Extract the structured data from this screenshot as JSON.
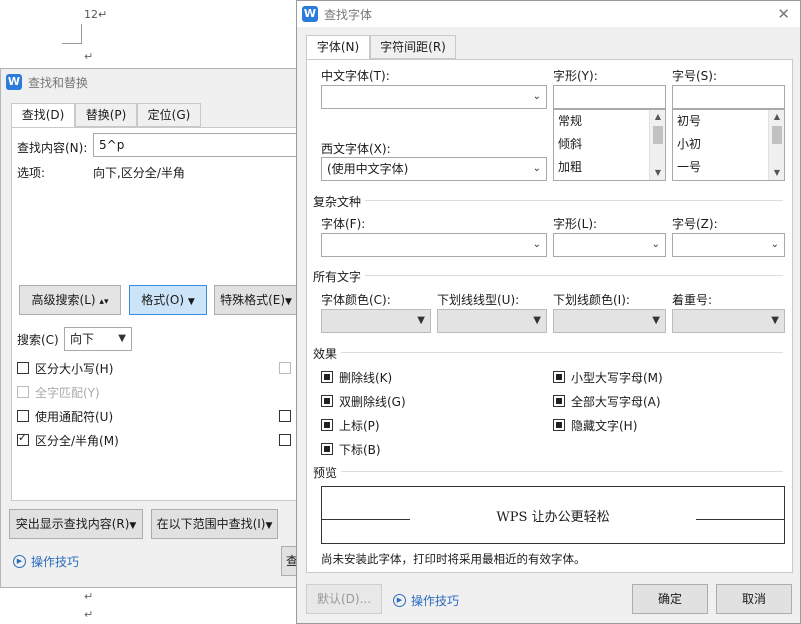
{
  "document": {
    "page_number_text": "12↵",
    "para_marks": [
      "↵",
      "↵",
      "↵"
    ]
  },
  "find_replace": {
    "title": "查找和替换",
    "tabs": [
      "查找(D)",
      "替换(P)",
      "定位(G)"
    ],
    "find_label": "查找内容(N):",
    "find_value": "5^p",
    "options_label": "选项:",
    "options_value": "向下,区分全/半角",
    "advanced_button": "高级搜索(L)",
    "format_button": "格式(O)",
    "special_button": "特殊格式(E)",
    "search_label": "搜索(C)",
    "search_value": "向下",
    "checkboxes": [
      {
        "label": "区分大小写(H)",
        "checked": false,
        "disabled": false
      },
      {
        "label": "全字匹配(Y)",
        "checked": false,
        "disabled": true
      },
      {
        "label": "使用通配符(U)",
        "checked": false,
        "disabled": false
      },
      {
        "label": "区分全/半角(M)",
        "checked": true,
        "disabled": false
      }
    ],
    "highlight_button": "突出显示查找内容(R)",
    "find_in_button": "在以下范围中查找(I)",
    "find_next_partial": "查",
    "tips_label": "操作技巧"
  },
  "find_font": {
    "title": "查找字体",
    "tabs": [
      "字体(N)",
      "字符间距(R)"
    ],
    "chinese_font_label": "中文字体(T):",
    "chinese_font_value": "",
    "style_label": "字形(Y):",
    "style_value": "",
    "style_options": [
      "常规",
      "倾斜",
      "加粗"
    ],
    "size_label": "字号(S):",
    "size_value": "",
    "size_options": [
      "初号",
      "小初",
      "一号"
    ],
    "western_font_label": "西文字体(X):",
    "western_font_value": "(使用中文字体)",
    "complex_section": "复杂文种",
    "complex_font_label": "字体(F):",
    "complex_style_label": "字形(L):",
    "complex_size_label": "字号(Z):",
    "all_text_section": "所有文字",
    "font_color_label": "字体颜色(C):",
    "underline_type_label": "下划线线型(U):",
    "underline_color_label": "下划线颜色(I):",
    "emphasis_label": "着重号:",
    "effects_section": "效果",
    "effects_left": [
      "删除线(K)",
      "双删除线(G)",
      "上标(P)",
      "下标(B)"
    ],
    "effects_right": [
      "小型大写字母(M)",
      "全部大写字母(A)",
      "隐藏文字(H)"
    ],
    "preview_section": "预览",
    "preview_text": "WPS 让办公更轻松",
    "note": "尚未安装此字体，打印时将采用最相近的有效字体。",
    "default_button": "默认(D)...",
    "tips_label": "操作技巧",
    "ok_button": "确定",
    "cancel_button": "取消",
    "close_glyph": "✕"
  }
}
